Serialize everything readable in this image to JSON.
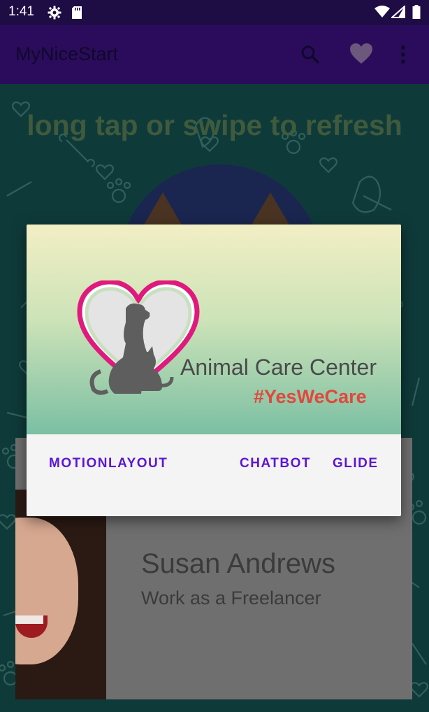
{
  "status_bar": {
    "time": "1:41"
  },
  "app_bar": {
    "title": "MyNiceStart"
  },
  "content": {
    "refresh_hint": "long tap or swipe to refresh",
    "person_card": {
      "name": "Susan Andrews",
      "job": "Work as a Freelancer"
    }
  },
  "dialog": {
    "center_name": "Animal Care Center",
    "tagline": "#YesWeCare",
    "buttons": {
      "motionlayout": "MOTIONLAYOUT",
      "chatbot": "CHATBOT",
      "glide": "GLIDE"
    }
  },
  "colors": {
    "status_bar": "#1e0c44",
    "app_bar": "#2b0c5c",
    "accent": "#5b16d2",
    "tagline": "#e2473c",
    "logo_heart": "#e0197d"
  }
}
